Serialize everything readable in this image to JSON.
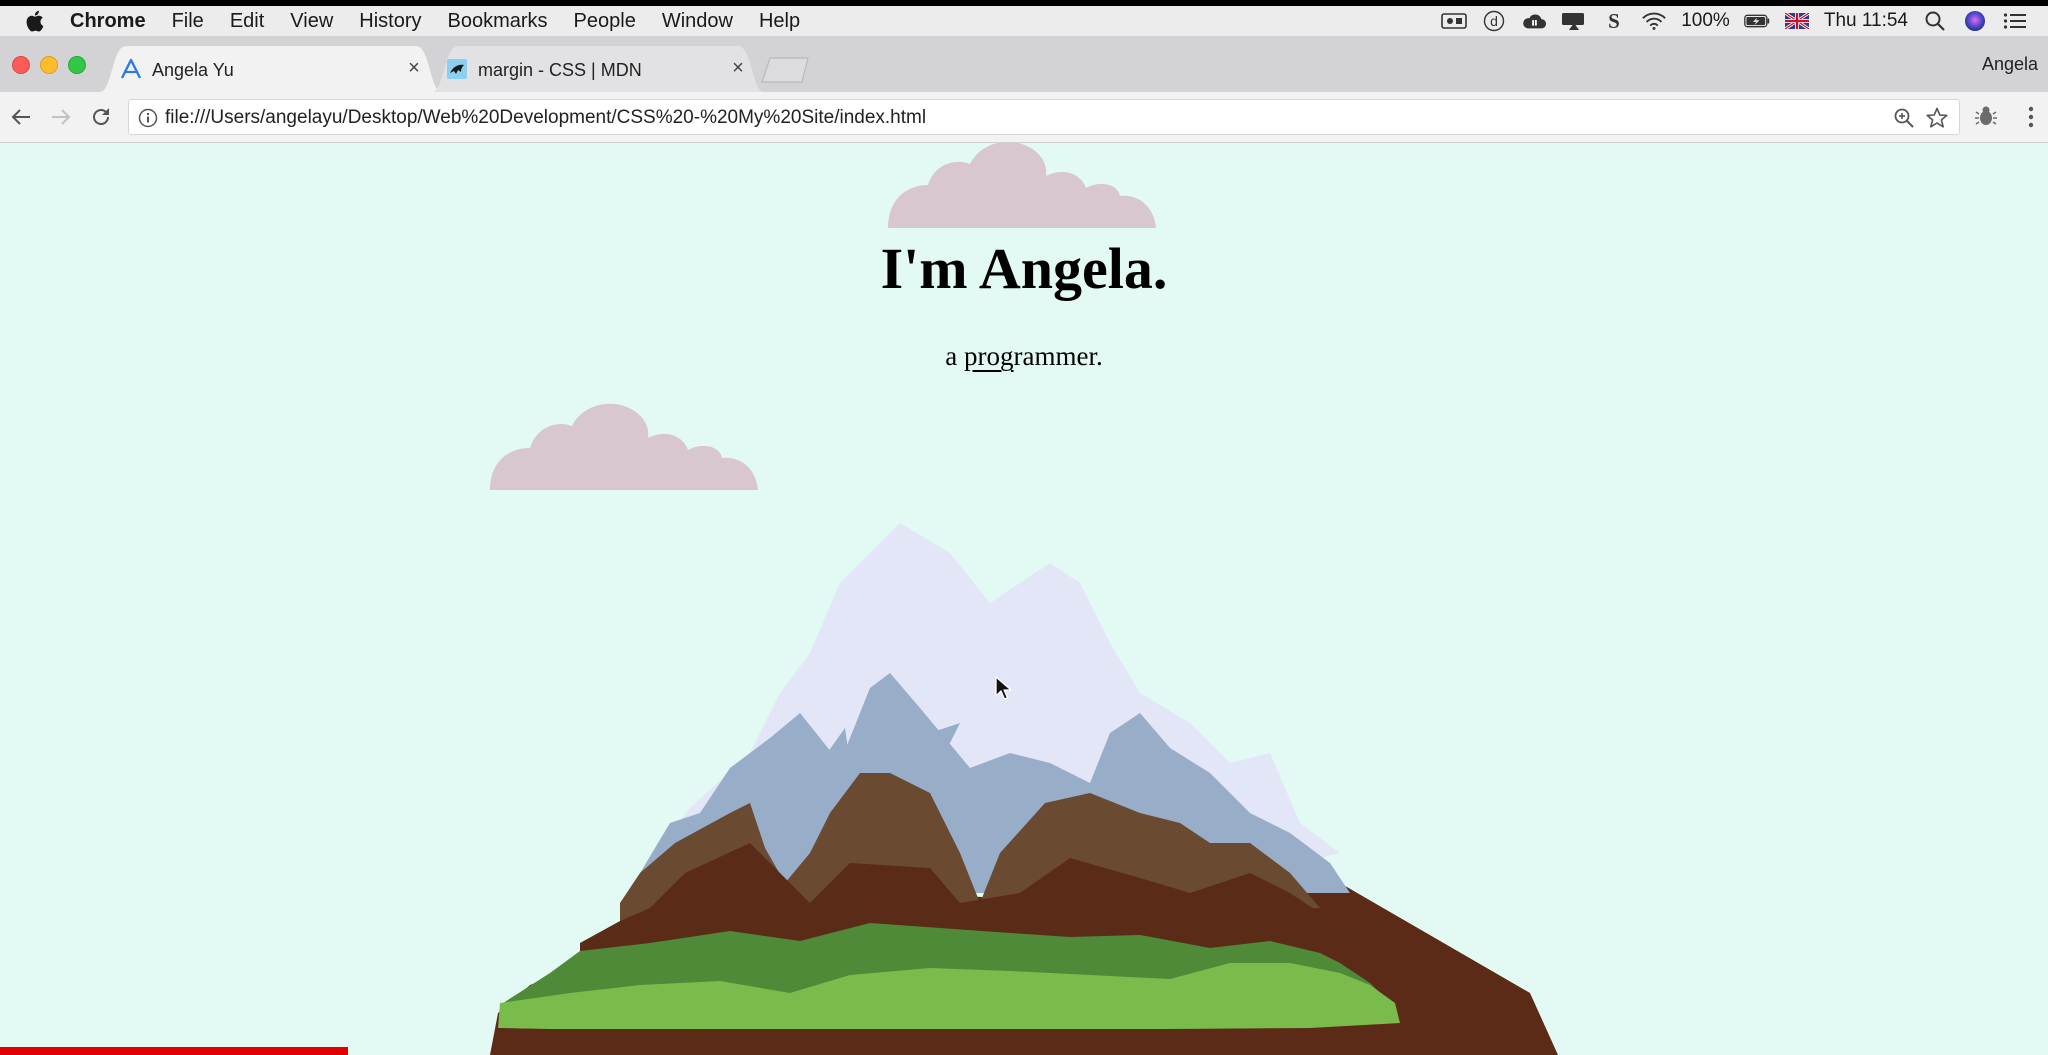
{
  "menubar": {
    "app_name": "Chrome",
    "items": [
      "File",
      "Edit",
      "View",
      "History",
      "Bookmarks",
      "People",
      "Window",
      "Help"
    ],
    "battery": "100%",
    "clock": "Thu 11:54"
  },
  "tabs": [
    {
      "title": "Angela Yu",
      "icon": "angela-yu-icon",
      "active": true
    },
    {
      "title": "margin - CSS | MDN",
      "icon": "mdn-icon",
      "active": false
    }
  ],
  "profile_name": "Angela",
  "toolbar": {
    "url": "file:///Users/angelayu/Desktop/Web%20Development/CSS%20-%20My%20Site/index.html"
  },
  "page": {
    "heading": "I'm Angela.",
    "sub_prefix": "a ",
    "sub_underlined": "prog",
    "sub_suffix": "rammer.",
    "background": "#e3faf4",
    "cloud_color": "#d8c6d0"
  },
  "video_progress": 0.17
}
